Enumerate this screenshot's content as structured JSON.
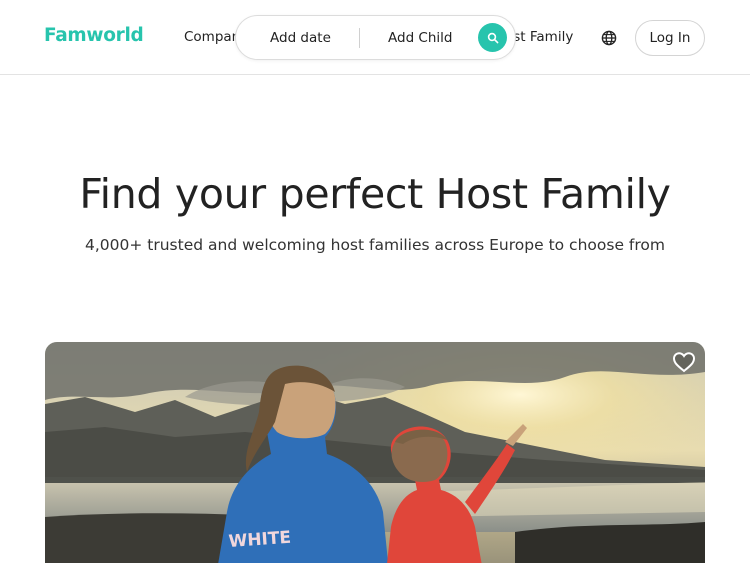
{
  "header": {
    "logo": "Famworld",
    "nav_companies": "Compan",
    "nav_host": "ost Family",
    "login_label": "Log In",
    "globe_icon": "globe-icon"
  },
  "search": {
    "date_label": "Add date",
    "child_label": "Add Child",
    "icon": "search-icon"
  },
  "hero": {
    "title": "Find your perfect Host Family",
    "subtitle": "4,000+ trusted and welcoming host families across Europe to choose from"
  },
  "card": {
    "favorite_icon": "heart-icon",
    "hoodie_text": "WHITE"
  },
  "colors": {
    "brand": "#27c4ad",
    "text": "#222222",
    "border": "#dcdcdc"
  }
}
